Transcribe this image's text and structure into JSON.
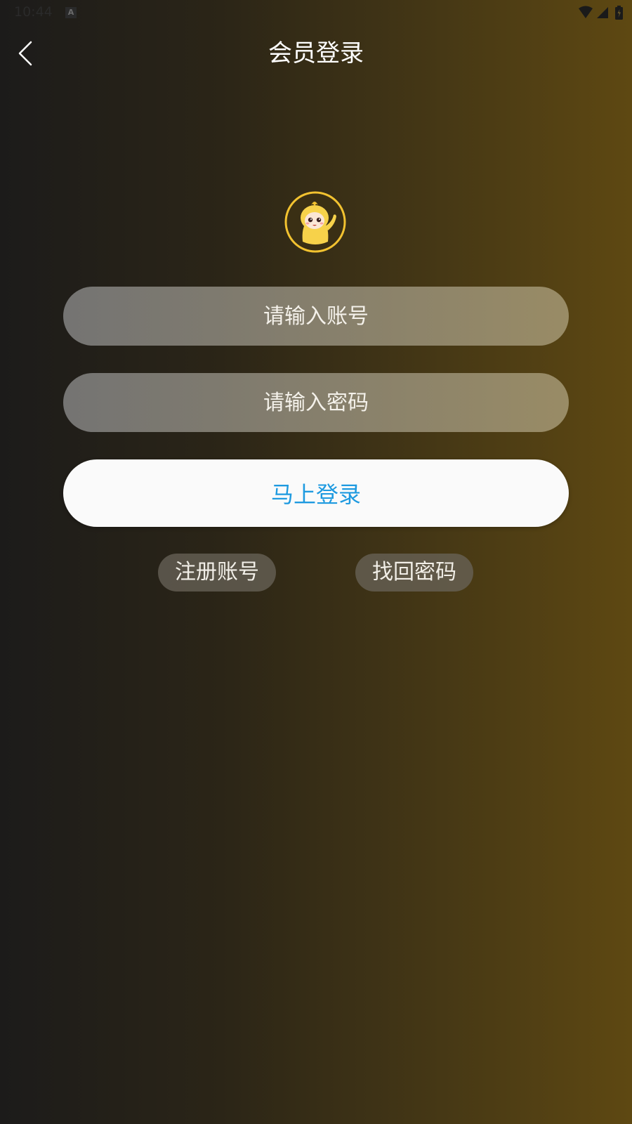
{
  "status_bar": {
    "time": "10:44",
    "notification_icon": "a-letter-icon",
    "icons": [
      "wifi-icon",
      "cellular-signal-icon",
      "battery-charging-icon"
    ]
  },
  "header": {
    "title": "会员登录",
    "back_icon": "chevron-left-icon"
  },
  "avatar": {
    "icon": "mascot-avatar-icon",
    "ring_color": "#f2c230",
    "fill_color": "#f7d24a"
  },
  "form": {
    "account_placeholder": "请输入账号",
    "password_placeholder": "请输入密码",
    "login_label": "马上登录",
    "login_color": "#1e9ae0"
  },
  "links": {
    "register": "注册账号",
    "recover_password": "找回密码"
  }
}
